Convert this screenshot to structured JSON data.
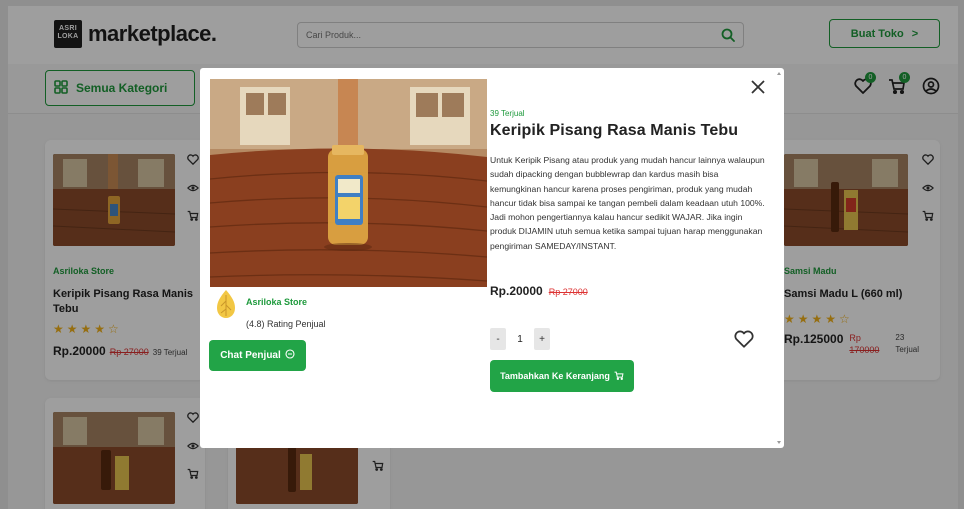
{
  "header": {
    "brand": "marketplace.",
    "logo_text_1": "ASRI",
    "logo_text_2": "LOKA",
    "search_placeholder": "Cari Produk...",
    "buat_toko_label": "Buat Toko",
    "buat_toko_arrow": ">",
    "cart_badge": "0",
    "wishlist_badge": "0"
  },
  "category": {
    "label": "Semua Kategori"
  },
  "cards": [
    {
      "store": "Asriloka Store",
      "name_line1": "Keripik Pisang Rasa Manis",
      "name_line2": "Tebu",
      "stars": "★★★★☆",
      "price": "Rp.20000",
      "old_price": "Rp 27000",
      "sold": "39 Terjual"
    },
    {
      "store": "Samsi Madu",
      "name_line1": "Samsi Madu L (660 ml)",
      "name_line2": "",
      "stars": "★★★★☆",
      "price": "Rp.125000",
      "old_price_1": "Rp",
      "old_price_2": "170000",
      "sold_1": "23",
      "sold_2": "Terjual"
    }
  ],
  "modal": {
    "sold": "39 Terjual",
    "title": "Keripik Pisang Rasa Manis Tebu",
    "description": "Untuk Keripik Pisang atau produk yang mudah hancur lainnya walaupun sudah dipacking dengan bubblewrap dan kardus masih bisa kemungkinan hancur karena proses pengiriman, produk yang mudah hancur tidak bisa sampai ke tangan pembeli dalam keadaan utuh 100%. Jadi mohon pengertiannya kalau hancur sedikit WAJAR. Jika ingin produk DIJAMIN utuh semua ketika sampai tujuan harap menggunakan pengiriman SAMEDAY/INSTANT.",
    "price": "Rp.20000",
    "old_price": "Rp 27000",
    "store_name": "Asriloka Store",
    "rating": "(4.8) Rating Penjual",
    "chat_label": "Chat Penjual",
    "qty_minus": "-",
    "qty_value": "1",
    "qty_plus": "+",
    "add_to_cart_label": "Tambahkan Ke Keranjang",
    "close_symbol": "✕"
  },
  "colors": {
    "accent": "#22a447",
    "accent_dark": "#1f9a3d",
    "strike": "#dd3333",
    "star": "#f2b21b"
  },
  "icons": [
    "search-icon",
    "chevron-right-icon",
    "grid-icon",
    "heart-icon",
    "cart-icon",
    "user-icon",
    "eye-icon",
    "close-icon",
    "chat-icon"
  ]
}
